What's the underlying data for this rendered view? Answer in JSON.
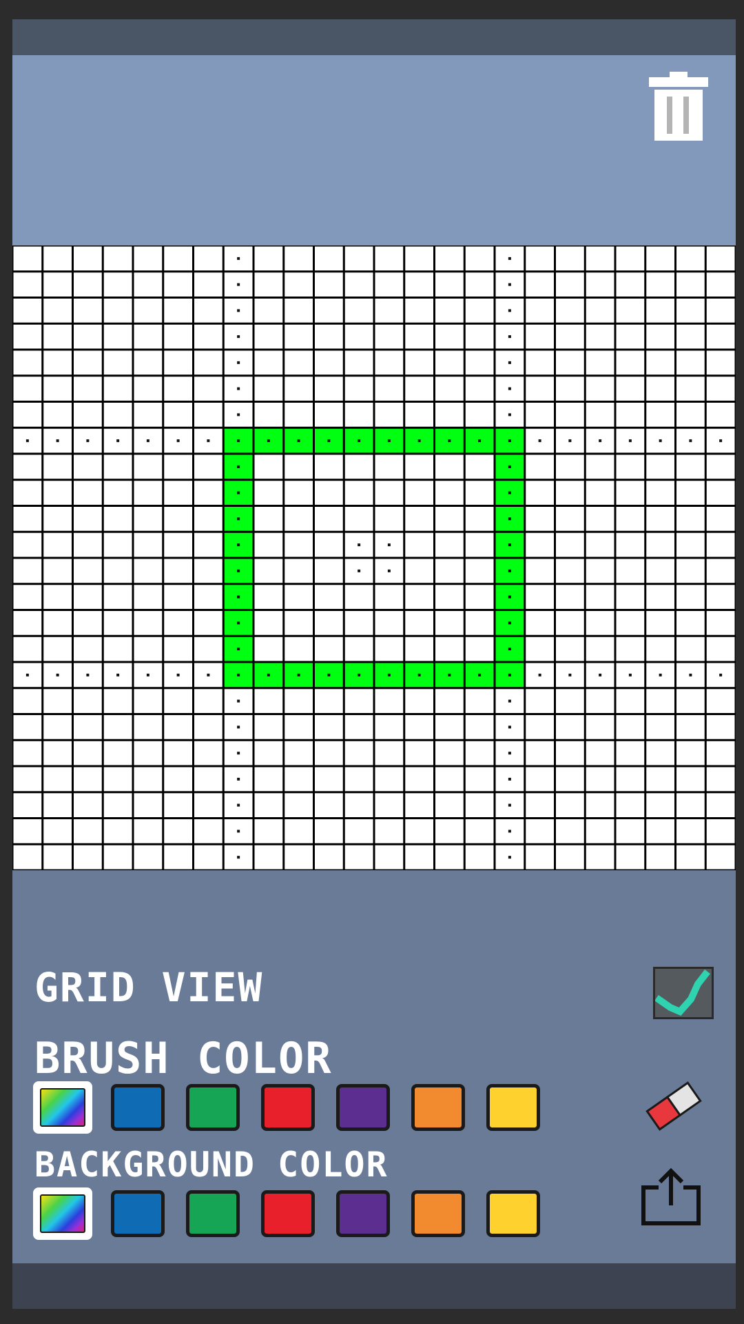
{
  "labels": {
    "grid_view": "GRID VIEW",
    "brush_color": "BRUSH COLOR",
    "background_color": "BACKGROUND COLOR"
  },
  "grid_view_enabled": true,
  "icons": {
    "trash": "trash-icon",
    "checkbox": "checkmark-icon",
    "eraser": "eraser-icon",
    "share": "share-icon"
  },
  "colors": {
    "header_bg": "#8399bb",
    "controls_bg": "#6a7b98",
    "grid_line": "#000000",
    "cell_empty": "#ffffff",
    "cell_filled": "#00ff11",
    "check_mark": "#2fd3b0"
  },
  "palette": [
    {
      "name": "rainbow",
      "hex": "rainbow"
    },
    {
      "name": "blue",
      "hex": "#0f6bb4"
    },
    {
      "name": "green",
      "hex": "#16a555"
    },
    {
      "name": "red",
      "hex": "#e8202c"
    },
    {
      "name": "purple",
      "hex": "#5c2e90"
    },
    {
      "name": "orange",
      "hex": "#f28a30"
    },
    {
      "name": "yellow",
      "hex": "#ffd12f"
    }
  ],
  "brush_selected": "rainbow",
  "background_selected": "rainbow",
  "canvas": {
    "cols": 24,
    "rows": 24,
    "filled_rect": {
      "col_start": 7,
      "row_start": 7,
      "col_end": 16,
      "row_end": 16
    },
    "guide_cols": [
      7,
      16
    ],
    "guide_rows": [
      7,
      16
    ],
    "center_dots": [
      [
        11,
        11
      ],
      [
        12,
        11
      ],
      [
        11,
        12
      ],
      [
        12,
        12
      ]
    ]
  }
}
